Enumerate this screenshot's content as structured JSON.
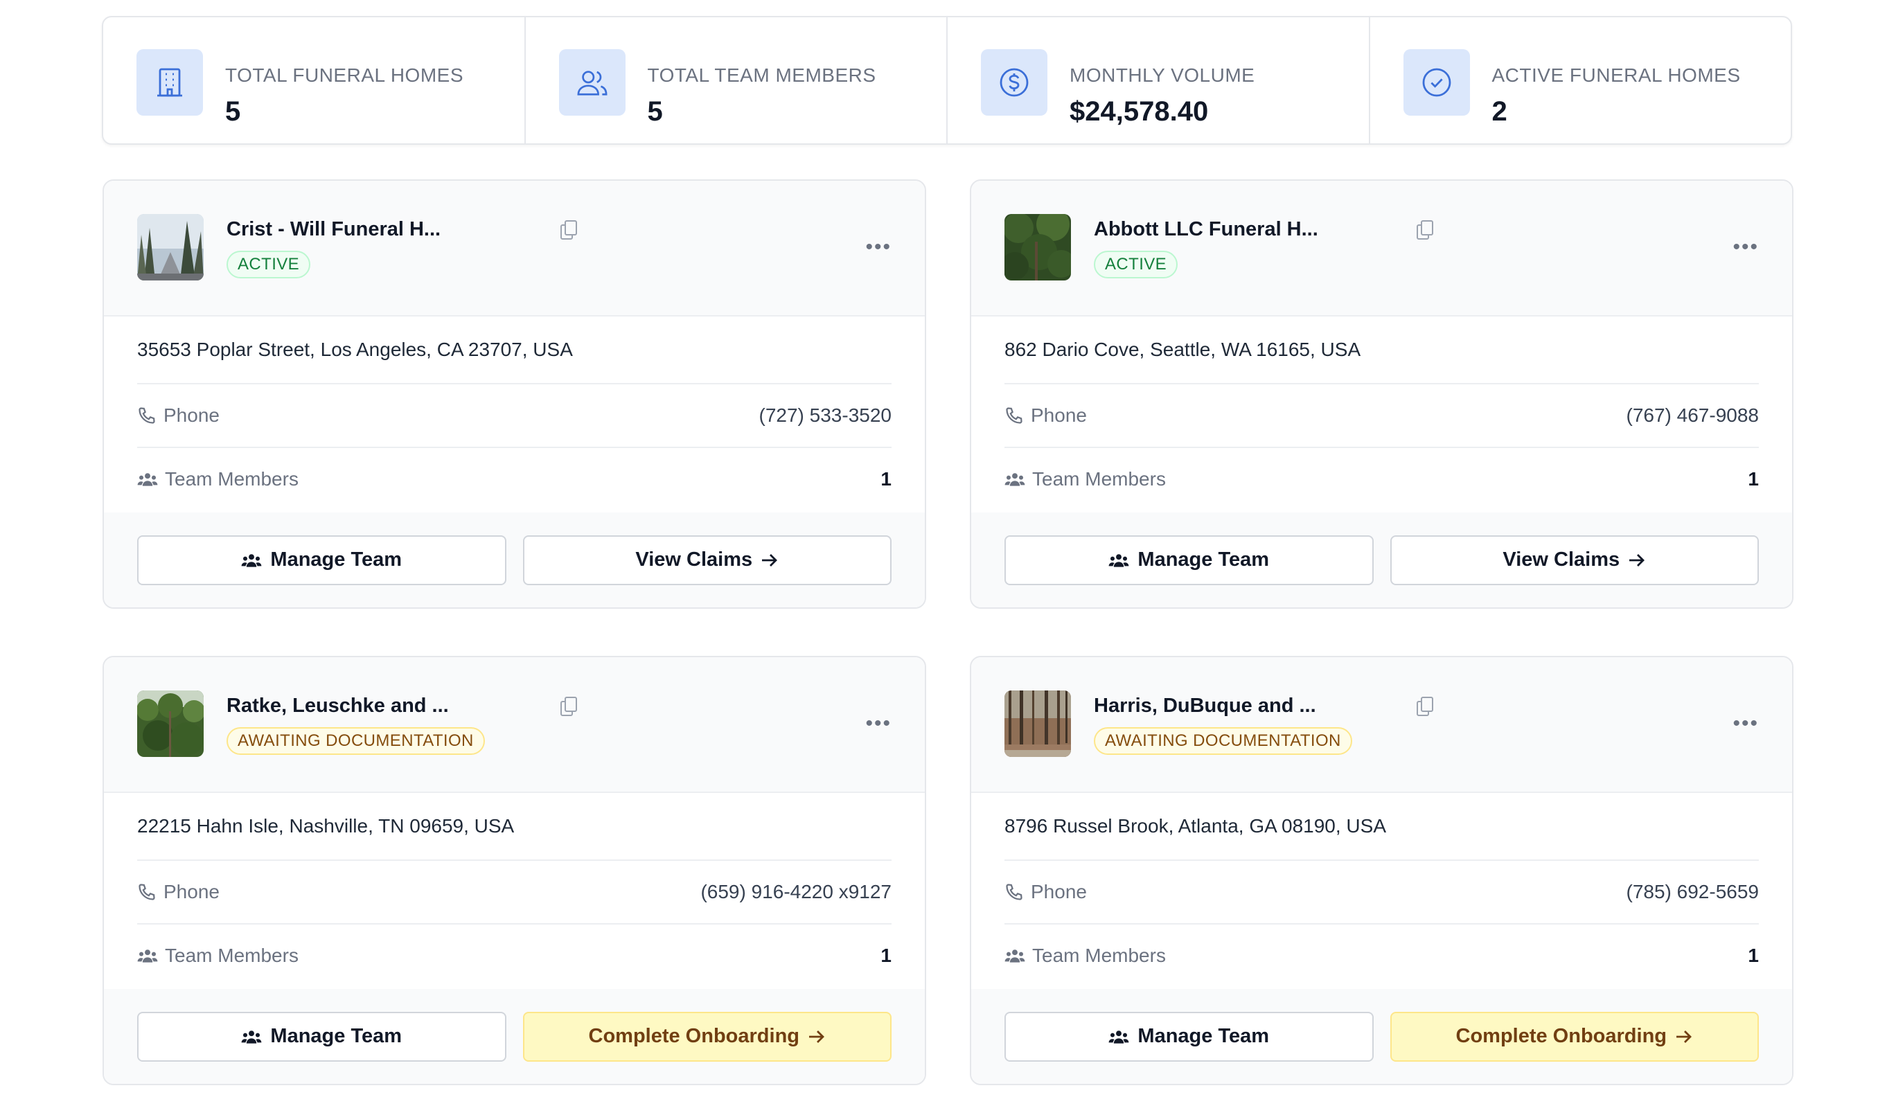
{
  "stats": [
    {
      "label": "TOTAL FUNERAL HOMES",
      "value": "5",
      "icon": "building-icon"
    },
    {
      "label": "TOTAL TEAM MEMBERS",
      "value": "5",
      "icon": "users-icon"
    },
    {
      "label": "MONTHLY VOLUME",
      "value": "$24,578.40",
      "icon": "dollar-circle-icon"
    },
    {
      "label": "ACTIVE FUNERAL HOMES",
      "value": "2",
      "icon": "check-circle-icon"
    }
  ],
  "cards": [
    {
      "name": "Crist - Will Funeral H...",
      "status": "ACTIVE",
      "address": "35653 Poplar Street, Los Angeles, CA 23707, USA",
      "phone_label": "Phone",
      "phone": "(727) 533-3520",
      "team_label": "Team Members",
      "team_count": "1",
      "manage_label": "Manage Team",
      "action_label": "View Claims"
    },
    {
      "name": "Abbott LLC Funeral H...",
      "status": "ACTIVE",
      "address": "862 Dario Cove, Seattle, WA 16165, USA",
      "phone_label": "Phone",
      "phone": "(767) 467-9088",
      "team_label": "Team Members",
      "team_count": "1",
      "manage_label": "Manage Team",
      "action_label": "View Claims"
    },
    {
      "name": "Ratke, Leuschke and ...",
      "status": "AWAITING DOCUMENTATION",
      "address": "22215 Hahn Isle, Nashville, TN 09659, USA",
      "phone_label": "Phone",
      "phone": "(659) 916-4220 x9127",
      "team_label": "Team Members",
      "team_count": "1",
      "manage_label": "Manage Team",
      "action_label": "Complete Onboarding"
    },
    {
      "name": "Harris, DuBuque and ...",
      "status": "AWAITING DOCUMENTATION",
      "address": "8796 Russel Brook, Atlanta, GA 08190, USA",
      "phone_label": "Phone",
      "phone": "(785) 692-5659",
      "team_label": "Team Members",
      "team_count": "1",
      "manage_label": "Manage Team",
      "action_label": "Complete Onboarding"
    }
  ],
  "colors": {
    "accent_bg": "#dbe7fb",
    "accent": "#3b6fd8",
    "active": "#15803d",
    "awaiting": "#854d0e",
    "onboarding_bg": "#fef9c3"
  }
}
